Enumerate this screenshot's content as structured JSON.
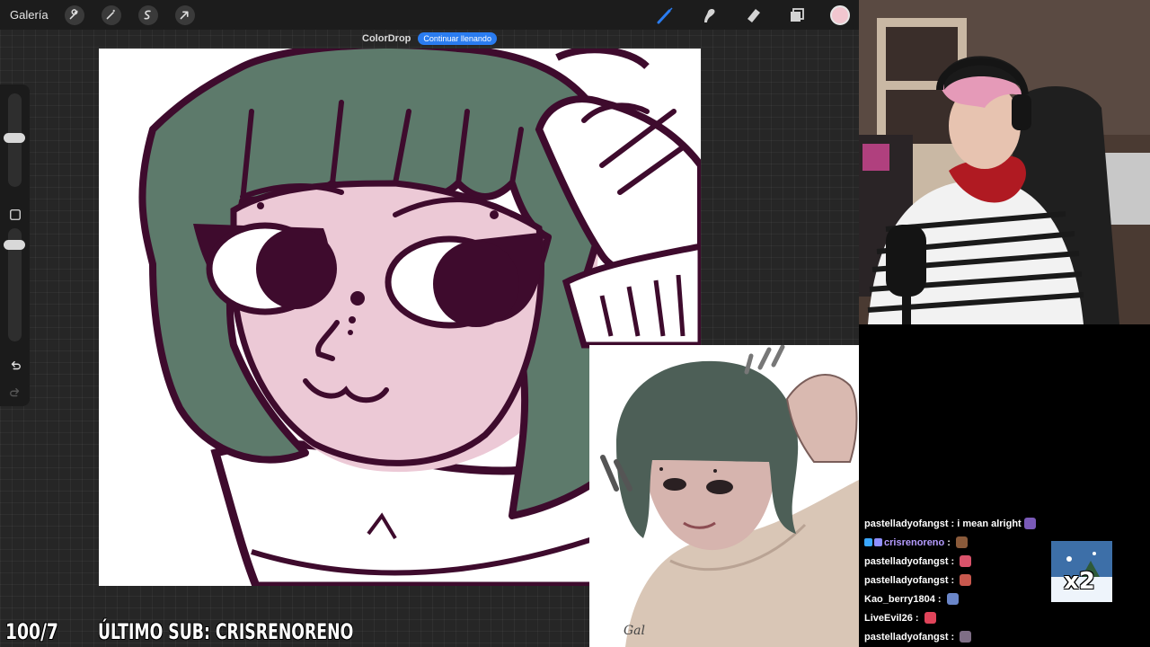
{
  "topbar": {
    "gallery_label": "Galería",
    "left_tools": [
      "wrench-icon",
      "magic-wand-icon",
      "selection-icon",
      "transform-arrow-icon"
    ],
    "right_tools": [
      "brush-icon",
      "smudge-icon",
      "eraser-icon",
      "layers-icon"
    ],
    "active_tool": "brush-icon",
    "accent_color": "#2a7cf0",
    "current_color": "#f1c6cf"
  },
  "colordrop": {
    "title": "ColorDrop",
    "button_label": "Continuar llenando"
  },
  "sidebar": {
    "icons": [
      "modify-square-icon",
      "undo-icon",
      "redo-icon"
    ]
  },
  "artwork": {
    "palette": {
      "line": "#3e0b2d",
      "hair": "#5d7a6b",
      "skin": "#ecc9d6",
      "white": "#ffffff"
    }
  },
  "reference": {
    "signature": "Gal"
  },
  "ticker": {
    "counter": "100/7",
    "last_sub": "ÚLTIMO SUB: CRISRENORENO"
  },
  "chat": {
    "messages": [
      {
        "user": "pastelladyofangst",
        "text": "i mean alright",
        "emote_color": "#7a5ab8",
        "name_color": "#ffffff"
      },
      {
        "user": "crisrenoreno",
        "text": "",
        "emote_color": "#8a5a3a",
        "name_color": "#b59cff",
        "badges": [
          "#3aa8ff",
          "#8f8fff"
        ]
      },
      {
        "user": "pastelladyofangst",
        "text": "",
        "emote_color": "#d9536b",
        "name_color": "#ffffff"
      },
      {
        "user": "pastelladyofangst",
        "text": "",
        "emote_color": "#c8584e",
        "name_color": "#ffffff"
      },
      {
        "user": "Kao_berry1804",
        "text": "",
        "emote_color": "#6a86c9",
        "name_color": "#ffffff"
      },
      {
        "user": "LiveEvil26",
        "text": "",
        "emote_color": "#e0445a",
        "name_color": "#ffffff"
      },
      {
        "user": "pastelladyofangst",
        "text": "",
        "emote_color": "#7f6e86",
        "name_color": "#ffffff"
      }
    ],
    "gift": {
      "multiplier": "x2"
    }
  }
}
